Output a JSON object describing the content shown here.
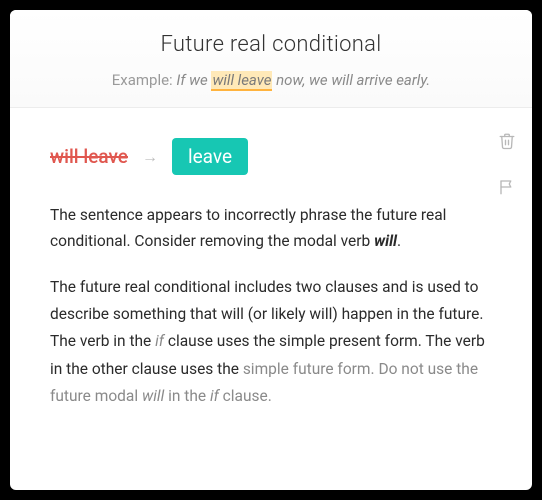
{
  "header": {
    "title": "Future real conditional",
    "example_label": "Example:",
    "example_pre": "If we ",
    "example_highlight": "will leave",
    "example_post": " now, we will arrive early."
  },
  "correction": {
    "original": "will leave",
    "arrow": "→",
    "suggestion": "leave"
  },
  "explanation": {
    "p1_pre": "The sentence appears to incorrectly phrase the future real conditional. Consider removing the modal verb ",
    "p1_bold": "will",
    "p1_post": ".",
    "p2_a": "The future real conditional includes two clauses and is used to describe something that will (or likely will) happen in the future. The verb in the ",
    "p2_if1": "if",
    "p2_b": " clause uses the simple present form. The verb in the other clause uses the ",
    "p2_c": "simple future form. Do not use the future modal ",
    "p2_will": "will",
    "p2_d": " in the ",
    "p2_if2": "if",
    "p2_e": " clause."
  },
  "icons": {
    "trash": "trash-icon",
    "flag": "flag-icon"
  }
}
